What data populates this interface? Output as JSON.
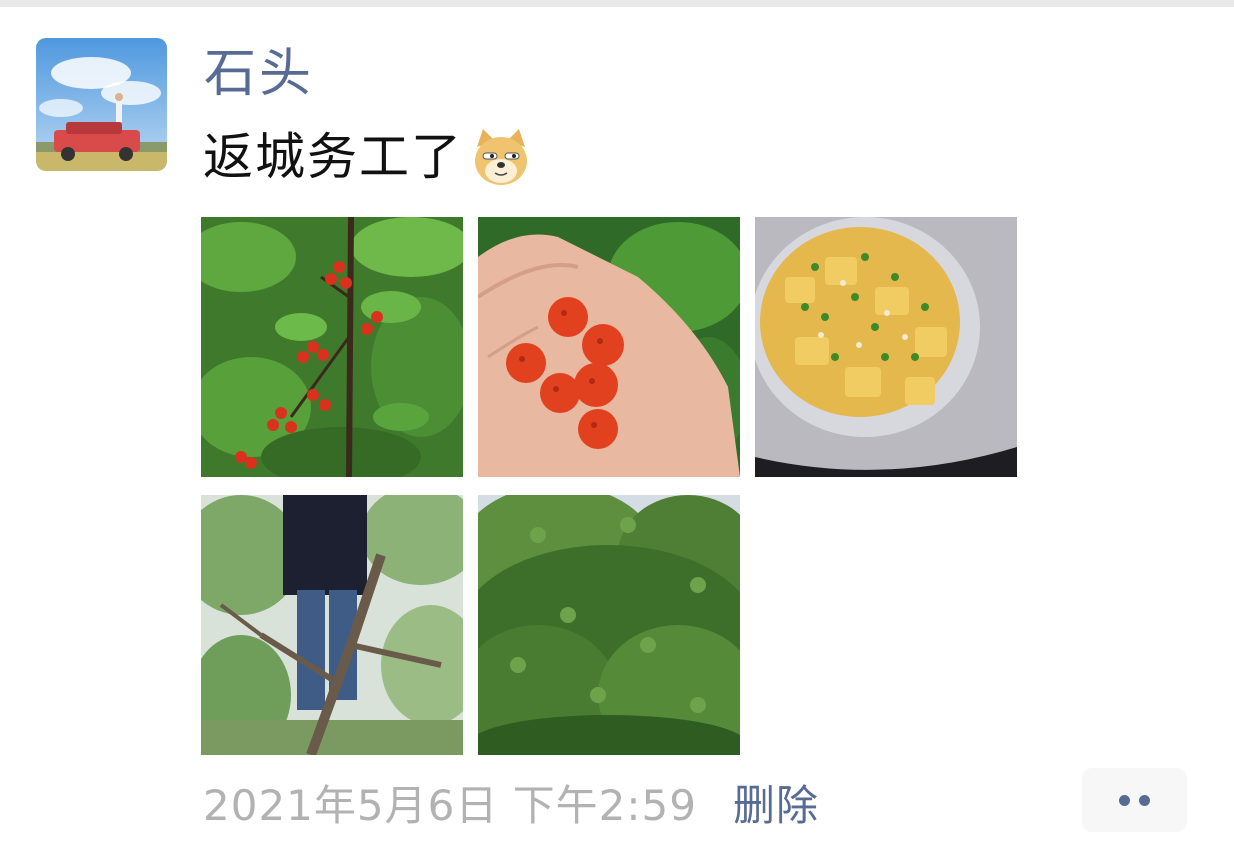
{
  "post": {
    "username": "石头",
    "text": "返城务工了",
    "emoji": "doge-emoji",
    "photos": [
      {
        "name": "photo-cherry-branch",
        "subject": "cherries on branch"
      },
      {
        "name": "photo-raspberries-hand",
        "subject": "raspberries in hand"
      },
      {
        "name": "photo-potato-dish",
        "subject": "potato dish"
      },
      {
        "name": "photo-person-in-tree",
        "subject": "person climbing tree"
      },
      {
        "name": "photo-green-trees",
        "subject": "green trees"
      }
    ],
    "timestamp": "2021年5月6日 下午2:59",
    "delete_label": "删除"
  },
  "colors": {
    "link": "#576b95",
    "timestamp": "#b2b2b2",
    "text": "#111111",
    "more_button_bg": "#f7f7f7"
  },
  "icons": {
    "more": "more-dots-icon"
  }
}
